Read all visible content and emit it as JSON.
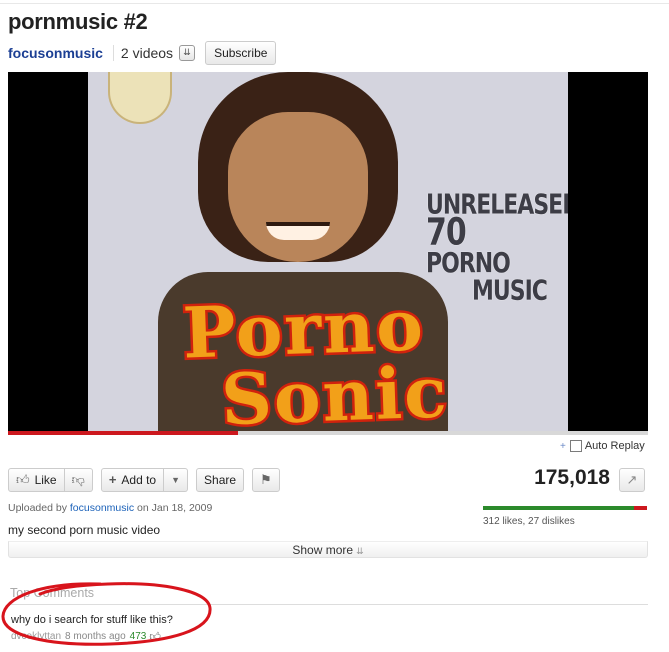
{
  "video": {
    "title": "pornmusic #2",
    "channel": "focusonmusic",
    "videos_count": "2 videos",
    "subscribe_label": "Subscribe",
    "playback_progress": 0.36,
    "poster": {
      "tag_line1": "UNRELEASED",
      "tag_num": "70",
      "tag_line2": "PORNO",
      "tag_line3": "MUSIC",
      "title_line1": "Porno",
      "title_line2": "Sonic"
    }
  },
  "controls": {
    "auto_replay_label": "Auto Replay",
    "like_label": "Like",
    "add_to_label": "Add to",
    "share_label": "Share",
    "views": "175,018"
  },
  "ratings": {
    "like_ratio": 0.92,
    "summary": "312 likes, 27 dislikes"
  },
  "upload": {
    "prefix": "Uploaded by",
    "uploader": "focusonmusic",
    "date_text": "on Jan 18, 2009",
    "description": "my second porn music video",
    "show_more_label": "Show more"
  },
  "comments": {
    "heading": "Top Comments",
    "items": [
      {
        "text": "why do i search for stuff like this?",
        "author": "dvcoklyttan",
        "age": "8 months ago",
        "score": "473"
      }
    ]
  },
  "icons": {
    "like": "thumbs-up-icon",
    "dislike": "thumbs-down-icon",
    "add": "plus-icon",
    "dropdown": "chevron-down-icon",
    "flag": "flag-icon",
    "stats": "stats-icon"
  },
  "colors": {
    "title_link": "#1c3f94",
    "progress": "#cc181e",
    "likes_bar": "#2b8a2b",
    "dislikes_bar": "#cc181e",
    "annotation": "#d8141c"
  }
}
